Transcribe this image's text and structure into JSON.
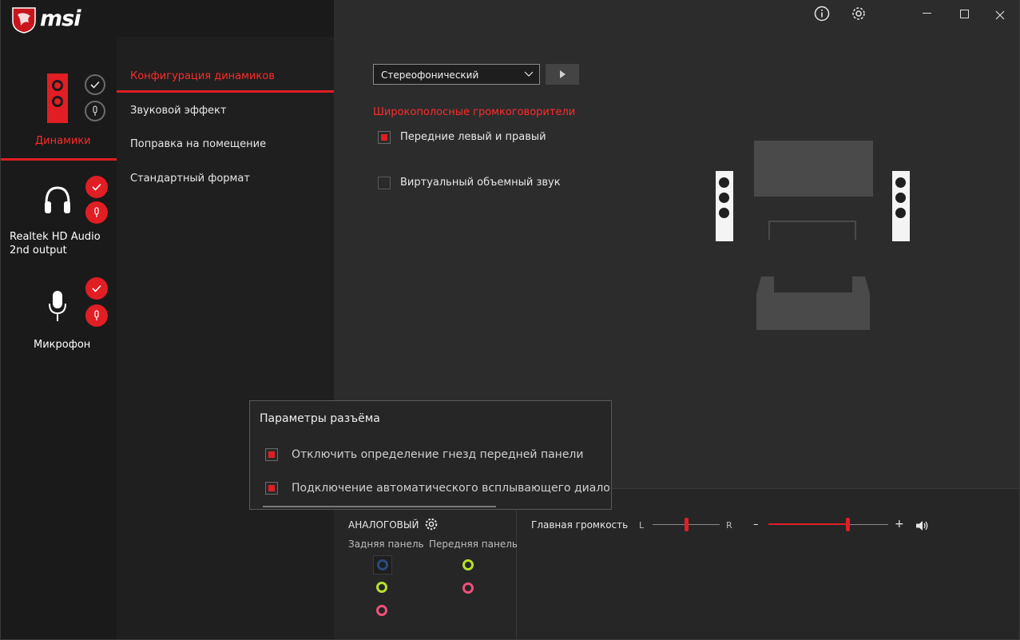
{
  "app": {
    "brand": "msi"
  },
  "devices": [
    {
      "label": "Динамики",
      "active": true
    },
    {
      "label": "Realtek HD Audio 2nd output",
      "active": false
    },
    {
      "label": "Микрофон",
      "active": false
    }
  ],
  "menu": [
    {
      "label": "Конфигурация динамиков",
      "active": true
    },
    {
      "label": "Звуковой эффект",
      "active": false
    },
    {
      "label": "Поправка на помещение",
      "active": false
    },
    {
      "label": "Стандартный формат",
      "active": false
    }
  ],
  "config": {
    "mode_selected": "Стереофонический",
    "section_title": "Широкополосные громкоговорители",
    "front_lr_label": "Передние левый и правый",
    "front_lr_checked": true,
    "virtual_surround_label": "Виртуальный объемный звук",
    "virtual_surround_checked": false
  },
  "popup": {
    "title": "Параметры разъёма",
    "option1": "Отключить определение гнезд передней панели",
    "option1_checked": true,
    "option2": "Подключение автоматического всплывающего диалога, д",
    "option2_checked": true
  },
  "analog": {
    "title": "АНАЛОГОВЫЙ",
    "rear_label": "Задняя панель",
    "front_label": "Передняя панель"
  },
  "volume": {
    "label": "Главная громкость",
    "balance_left": "L",
    "balance_right": "R",
    "minus": "–",
    "plus": "+",
    "balance_value": 0.5,
    "level": 0.66
  },
  "colors": {
    "accent": "#e01e24",
    "jack_green": "#b8e02a",
    "jack_pink": "#f0507a",
    "jack_blue": "#2a4a80"
  },
  "icons": {
    "info": "info-icon",
    "settings": "gear-icon",
    "minimize": "minimize-icon",
    "maximize": "maximize-icon",
    "close": "close-icon"
  }
}
